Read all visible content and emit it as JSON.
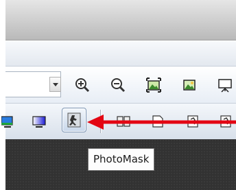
{
  "tooltip": {
    "text": "PhotoMask"
  },
  "toolbar_top": {
    "buttons": [
      "zoom-in-icon",
      "zoom-out-icon",
      "fit-image-icon",
      "actual-size-icon",
      "slideshow-icon"
    ]
  },
  "toolbar_bottom": {
    "buttons": [
      "color-swatch-icon",
      "gradient-icon",
      "photomask-icon",
      "compare-icon",
      "page-icon",
      "export-icon",
      "convert-icon"
    ]
  },
  "annotation": {
    "arrow_color": "#e30613"
  }
}
